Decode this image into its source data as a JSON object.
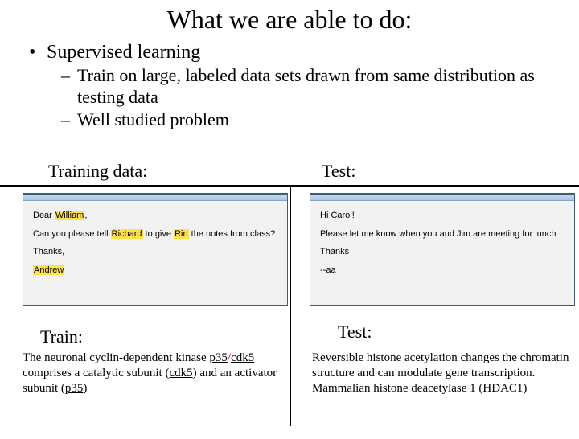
{
  "title": "What we are able to do:",
  "bullet1": "Supervised learning",
  "sub1": "Train on large, labeled data sets drawn from same distribution as testing data",
  "sub2": "Well studied problem",
  "labels": {
    "training_data": "Training data:",
    "test": "Test:",
    "train": "Train:",
    "test2": "Test:"
  },
  "email_left": {
    "greeting_prefix": "Dear ",
    "greeting_name": "William",
    "greeting_suffix": ",",
    "line_p1": "Can you please tell ",
    "line_hl1": "Richard",
    "line_p2": " to give ",
    "line_hl2": "Rin",
    "line_p3": " the notes from class?",
    "thanks": "Thanks,",
    "sig": "Andrew"
  },
  "email_right": {
    "greeting": "Hi Carol!",
    "line": "Please let me know when you and Jim are meeting for lunch",
    "thanks": "Thanks",
    "sig": "--aa"
  },
  "abstract_left": {
    "p1": "The neuronal cyclin-dependent kinase ",
    "u1": "p35",
    "slash": "/",
    "u2": "cdk5",
    "p2": " comprises a catalytic subunit (",
    "u3": "cdk5",
    "p3": ") and an activator subunit (",
    "u4": "p35",
    "p4": ")"
  },
  "abstract_right": "Reversible histone acetylation changes the chromatin structure and can modulate gene transcription. Mammalian histone deacetylase 1 (HDAC1)"
}
